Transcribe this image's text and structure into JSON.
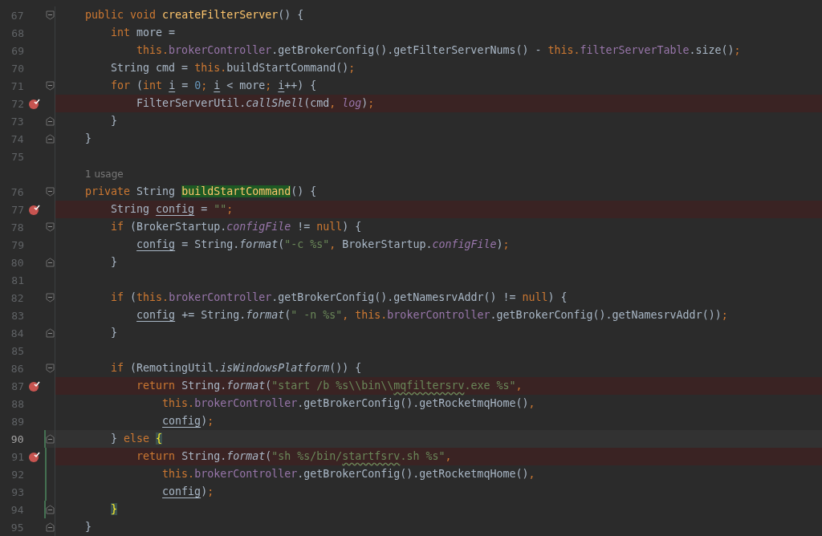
{
  "lines": [
    {
      "kind": "code",
      "number": "67",
      "fold_start": true,
      "tokens": [
        {
          "text": "    public void ",
          "kind": "keyword"
        },
        {
          "text": "createFilterServer",
          "kind": "declaration"
        },
        {
          "text": "() {",
          "kind": "plain"
        }
      ]
    },
    {
      "kind": "code",
      "number": "68",
      "tokens": [
        {
          "text": "        int",
          "kind": "keyword"
        },
        {
          "text": " more =",
          "kind": "plain"
        }
      ]
    },
    {
      "kind": "code",
      "number": "69",
      "tokens": [
        {
          "text": "            this.",
          "kind": "keyword"
        },
        {
          "text": "brokerController",
          "kind": "field"
        },
        {
          "text": ".getBrokerConfig().getFilterServerNums() - ",
          "kind": "plain"
        },
        {
          "text": "this.",
          "kind": "keyword"
        },
        {
          "text": "filterServerTable",
          "kind": "field"
        },
        {
          "text": ".size()",
          "kind": "plain"
        },
        {
          "text": ";",
          "kind": "keyword"
        }
      ]
    },
    {
      "kind": "code",
      "number": "70",
      "tokens": [
        {
          "text": "        String cmd = ",
          "kind": "plain"
        },
        {
          "text": "this.",
          "kind": "keyword"
        },
        {
          "text": "buildStartCommand()",
          "kind": "plain"
        },
        {
          "text": ";",
          "kind": "keyword"
        }
      ]
    },
    {
      "kind": "code",
      "number": "71",
      "fold_start": true,
      "tokens": [
        {
          "text": "        for",
          "kind": "keyword"
        },
        {
          "text": " (",
          "kind": "plain"
        },
        {
          "text": "int ",
          "kind": "keyword"
        },
        {
          "text": "i",
          "kind": "local"
        },
        {
          "text": " = ",
          "kind": "plain"
        },
        {
          "text": "0",
          "kind": "number"
        },
        {
          "text": "; ",
          "kind": "keyword"
        },
        {
          "text": "i",
          "kind": "local"
        },
        {
          "text": " < more",
          "kind": "plain"
        },
        {
          "text": "; ",
          "kind": "keyword"
        },
        {
          "text": "i",
          "kind": "local"
        },
        {
          "text": "++) {",
          "kind": "plain"
        }
      ]
    },
    {
      "kind": "code",
      "number": "72",
      "breakpoint": true,
      "tokens": [
        {
          "text": "            FilterServerUtil.",
          "kind": "plain"
        },
        {
          "text": "callShell",
          "kind": "static_call"
        },
        {
          "text": "(cmd",
          "kind": "plain"
        },
        {
          "text": ", ",
          "kind": "keyword"
        },
        {
          "text": "log",
          "kind": "static_field"
        },
        {
          "text": ")",
          "kind": "plain"
        },
        {
          "text": ";",
          "kind": "keyword"
        }
      ]
    },
    {
      "kind": "code",
      "number": "73",
      "fold_end": true,
      "tokens": [
        {
          "text": "        }",
          "kind": "plain"
        }
      ]
    },
    {
      "kind": "code",
      "number": "74",
      "fold_end": true,
      "tokens": [
        {
          "text": "    }",
          "kind": "plain"
        }
      ]
    },
    {
      "kind": "code",
      "number": "75"
    },
    {
      "kind": "hint",
      "text": "1 usage"
    },
    {
      "kind": "code",
      "number": "76",
      "fold_start": true,
      "tokens": [
        {
          "text": "    private",
          "kind": "keyword"
        },
        {
          "text": " String ",
          "kind": "plain"
        },
        {
          "text": "buildStartCommand",
          "kind": "declaration",
          "matched": true
        },
        {
          "text": "() {",
          "kind": "plain"
        }
      ]
    },
    {
      "kind": "code",
      "number": "77",
      "breakpoint": true,
      "tokens": [
        {
          "text": "        String ",
          "kind": "plain"
        },
        {
          "text": "config",
          "kind": "local"
        },
        {
          "text": " = ",
          "kind": "plain"
        },
        {
          "text": "\"\"",
          "kind": "string"
        },
        {
          "text": ";",
          "kind": "keyword"
        }
      ]
    },
    {
      "kind": "code",
      "number": "78",
      "fold_start": true,
      "tokens": [
        {
          "text": "        if",
          "kind": "keyword"
        },
        {
          "text": " (BrokerStartup.",
          "kind": "plain"
        },
        {
          "text": "configFile",
          "kind": "static_field"
        },
        {
          "text": " != ",
          "kind": "plain"
        },
        {
          "text": "null",
          "kind": "keyword"
        },
        {
          "text": ") {",
          "kind": "plain"
        }
      ]
    },
    {
      "kind": "code",
      "number": "79",
      "tokens": [
        {
          "text": "            config",
          "kind": "local"
        },
        {
          "text": " = String.",
          "kind": "plain"
        },
        {
          "text": "format",
          "kind": "static_call"
        },
        {
          "text": "(",
          "kind": "plain"
        },
        {
          "text": "\"-c %s\"",
          "kind": "string"
        },
        {
          "text": ",",
          "kind": "keyword"
        },
        {
          "text": " BrokerStartup.",
          "kind": "plain"
        },
        {
          "text": "configFile",
          "kind": "static_field"
        },
        {
          "text": ")",
          "kind": "plain"
        },
        {
          "text": ";",
          "kind": "keyword"
        }
      ]
    },
    {
      "kind": "code",
      "number": "80",
      "fold_end": true,
      "tokens": [
        {
          "text": "        }",
          "kind": "plain"
        }
      ]
    },
    {
      "kind": "code",
      "number": "81"
    },
    {
      "kind": "code",
      "number": "82",
      "fold_start": true,
      "tokens": [
        {
          "text": "        if",
          "kind": "keyword"
        },
        {
          "text": " (",
          "kind": "plain"
        },
        {
          "text": "this.",
          "kind": "keyword"
        },
        {
          "text": "brokerController",
          "kind": "field"
        },
        {
          "text": ".getBrokerConfig().getNamesrvAddr() != ",
          "kind": "plain"
        },
        {
          "text": "null",
          "kind": "keyword"
        },
        {
          "text": ") {",
          "kind": "plain"
        }
      ]
    },
    {
      "kind": "code",
      "number": "83",
      "tokens": [
        {
          "text": "            config",
          "kind": "local"
        },
        {
          "text": " += String.",
          "kind": "plain"
        },
        {
          "text": "format",
          "kind": "static_call"
        },
        {
          "text": "(",
          "kind": "plain"
        },
        {
          "text": "\" -n %s\"",
          "kind": "string"
        },
        {
          "text": ", this.",
          "kind": "keyword"
        },
        {
          "text": "brokerController",
          "kind": "field"
        },
        {
          "text": ".getBrokerConfig().getNamesrvAddr())",
          "kind": "plain"
        },
        {
          "text": ";",
          "kind": "keyword"
        }
      ]
    },
    {
      "kind": "code",
      "number": "84",
      "fold_end": true,
      "tokens": [
        {
          "text": "        }",
          "kind": "plain"
        }
      ]
    },
    {
      "kind": "code",
      "number": "85"
    },
    {
      "kind": "code",
      "number": "86",
      "fold_start": true,
      "tokens": [
        {
          "text": "        if",
          "kind": "keyword"
        },
        {
          "text": " (RemotingUtil.",
          "kind": "plain"
        },
        {
          "text": "isWindowsPlatform",
          "kind": "static_call"
        },
        {
          "text": "()) {",
          "kind": "plain"
        }
      ]
    },
    {
      "kind": "code",
      "number": "87",
      "breakpoint": true,
      "tokens": [
        {
          "text": "            return",
          "kind": "keyword"
        },
        {
          "text": " String.",
          "kind": "plain"
        },
        {
          "text": "format",
          "kind": "static_call"
        },
        {
          "text": "(",
          "kind": "plain"
        },
        {
          "text": "\"start /b %s\\\\bin\\\\",
          "kind": "string"
        },
        {
          "text": "mqfiltersrv",
          "kind": "typo"
        },
        {
          "text": ".exe %s\"",
          "kind": "string"
        },
        {
          "text": ",",
          "kind": "keyword"
        }
      ]
    },
    {
      "kind": "code",
      "number": "88",
      "tokens": [
        {
          "text": "                this.",
          "kind": "keyword"
        },
        {
          "text": "brokerController",
          "kind": "field"
        },
        {
          "text": ".getBrokerConfig().getRocketmqHome()",
          "kind": "plain"
        },
        {
          "text": ",",
          "kind": "keyword"
        }
      ]
    },
    {
      "kind": "code",
      "number": "89",
      "tokens": [
        {
          "text": "                config",
          "kind": "local"
        },
        {
          "text": ")",
          "kind": "plain"
        },
        {
          "text": ";",
          "kind": "keyword"
        }
      ]
    },
    {
      "kind": "code",
      "number": "90",
      "fold_end": true,
      "current": true,
      "changed": true,
      "tokens": [
        {
          "text": "        } ",
          "kind": "plain"
        },
        {
          "text": "else ",
          "kind": "keyword"
        },
        {
          "text": "{",
          "kind": "plain",
          "matched": true
        }
      ]
    },
    {
      "kind": "code",
      "number": "91",
      "breakpoint": true,
      "changed": true,
      "tokens": [
        {
          "text": "            return",
          "kind": "keyword"
        },
        {
          "text": " String.",
          "kind": "plain"
        },
        {
          "text": "format",
          "kind": "static_call"
        },
        {
          "text": "(",
          "kind": "plain"
        },
        {
          "text": "\"sh %s/bin/",
          "kind": "string"
        },
        {
          "text": "startfsrv",
          "kind": "typo"
        },
        {
          "text": ".sh %s\"",
          "kind": "string"
        },
        {
          "text": ",",
          "kind": "keyword"
        }
      ]
    },
    {
      "kind": "code",
      "number": "92",
      "changed": true,
      "tokens": [
        {
          "text": "                this.",
          "kind": "keyword"
        },
        {
          "text": "brokerController",
          "kind": "field"
        },
        {
          "text": ".getBrokerConfig().getRocketmqHome()",
          "kind": "plain"
        },
        {
          "text": ",",
          "kind": "keyword"
        }
      ]
    },
    {
      "kind": "code",
      "number": "93",
      "changed": true,
      "tokens": [
        {
          "text": "                config",
          "kind": "local"
        },
        {
          "text": ")",
          "kind": "plain"
        },
        {
          "text": ";",
          "kind": "keyword"
        }
      ]
    },
    {
      "kind": "code",
      "number": "94",
      "fold_end": true,
      "changed": true,
      "tokens": [
        {
          "text": "        }",
          "kind": "plain",
          "matched": true
        }
      ]
    },
    {
      "kind": "code",
      "number": "95",
      "fold_end": true,
      "tokens": [
        {
          "text": "    }",
          "kind": "plain"
        }
      ]
    }
  ]
}
